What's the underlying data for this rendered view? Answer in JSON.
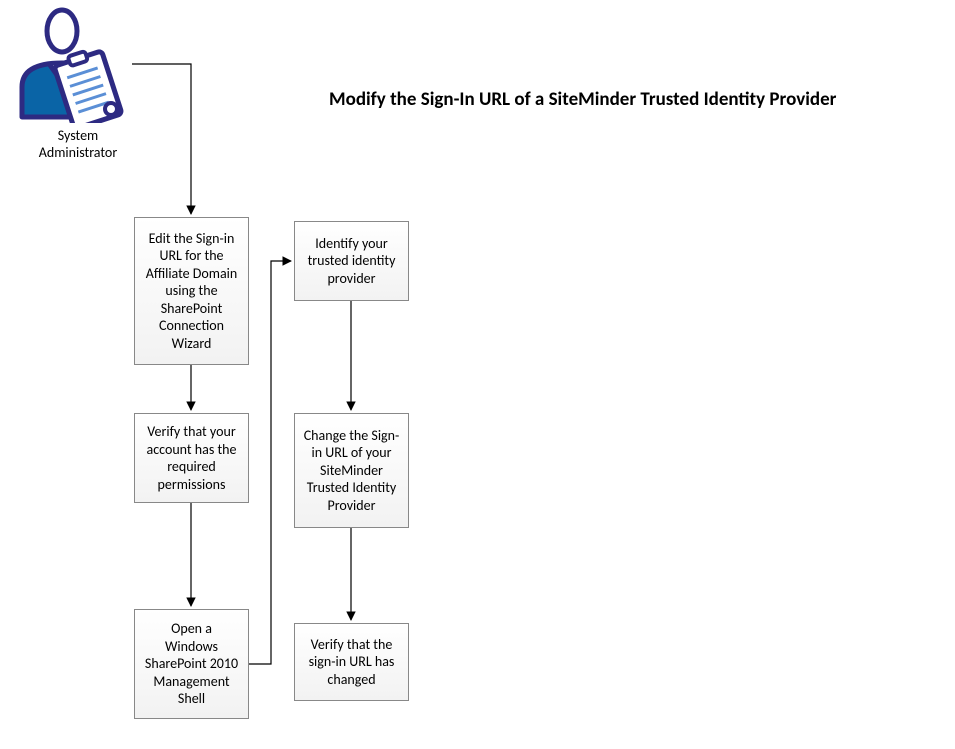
{
  "title": "Modify the Sign-In URL of a SiteMinder Trusted Identity Provider",
  "actor": {
    "label_line1": "System",
    "label_line2": "Administrator"
  },
  "steps": {
    "s1": "Edit the Sign-in URL for the Affiliate Domain using the SharePoint Connection Wizard",
    "s2": "Verify that your account has the required permissions",
    "s3": "Open a Windows SharePoint 2010 Management Shell",
    "s4": "Identify your trusted identity provider",
    "s5": "Change the Sign-in URL of your SiteMinder Trusted Identity Provider",
    "s6": "Verify that the sign-in URL has changed"
  }
}
